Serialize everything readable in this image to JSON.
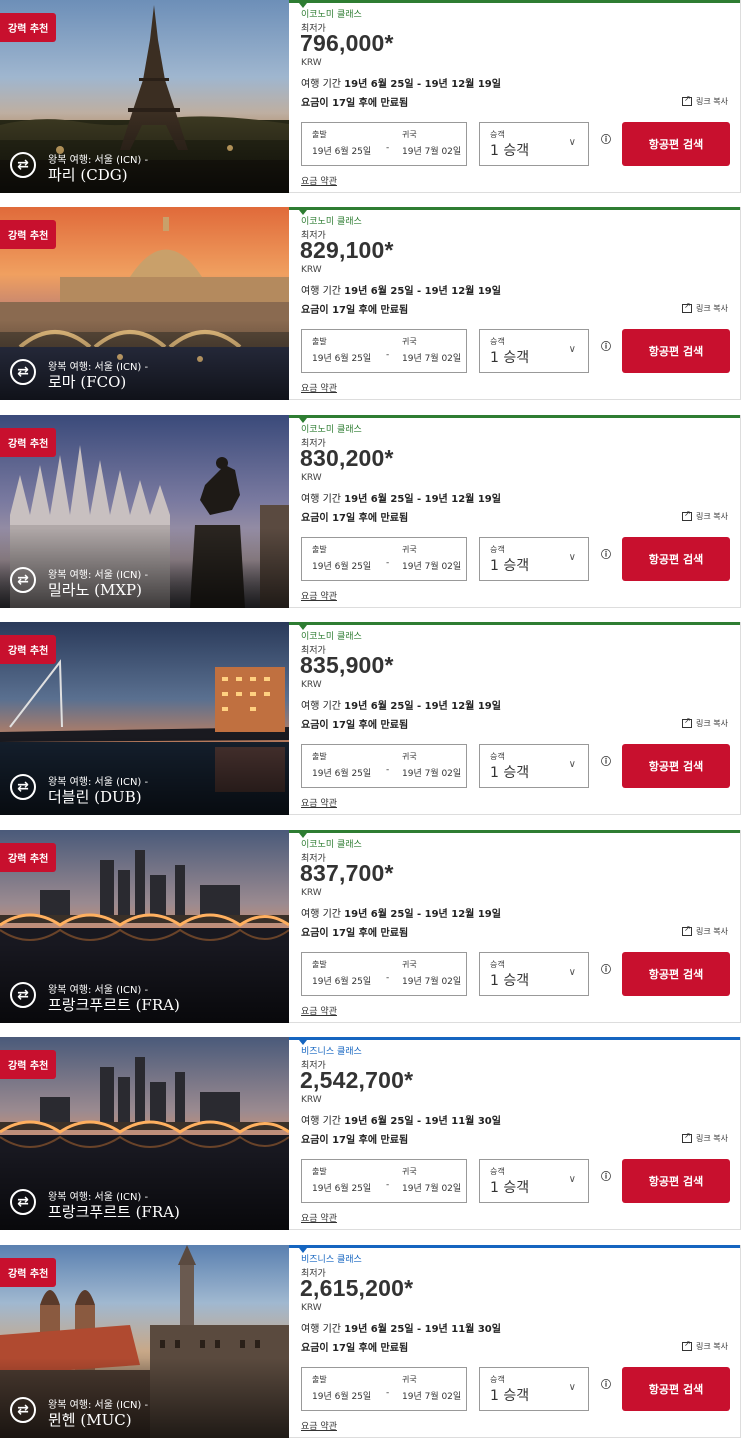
{
  "common": {
    "badge": "강력 추천",
    "route_prefix": "왕복 여행: 서울 (ICN) -",
    "lowest_label": "최저가",
    "currency": "KRW",
    "period_prefix": "여행 기간",
    "expiry": "요금이 17일 후에 만료됨",
    "copy_link": "링크 복사",
    "depart_label": "출발",
    "return_label": "귀국",
    "depart_date": "19년 6월 25일",
    "return_date": "19년 7월 02일",
    "dash": "-",
    "pax_label": "승객",
    "pax_value": "1 승객",
    "info_icon": "ⓘ",
    "search_button": "항공편 검색",
    "terms": "요금 약관",
    "colors": {
      "brand_red": "#c8102e",
      "economy_green": "#2e7d32",
      "business_blue": "#1565c0"
    }
  },
  "cards": [
    {
      "city": "파리 (CDG)",
      "cabin": "이코노미 클래스",
      "cabin_type": "economy",
      "price": "796,000*",
      "period": "19년 6월 25일 - 19년 12월 19일",
      "image": "paris-eiffel-tower"
    },
    {
      "city": "로마 (FCO)",
      "cabin": "이코노미 클래스",
      "cabin_type": "economy",
      "price": "829,100*",
      "period": "19년 6월 25일 - 19년 12월 19일",
      "image": "rome-st-peters"
    },
    {
      "city": "밀라노 (MXP)",
      "cabin": "이코노미 클래스",
      "cabin_type": "economy",
      "price": "830,200*",
      "period": "19년 6월 25일 - 19년 12월 19일",
      "image": "milan-duomo"
    },
    {
      "city": "더블린 (DUB)",
      "cabin": "이코노미 클래스",
      "cabin_type": "economy",
      "price": "835,900*",
      "period": "19년 6월 25일 - 19년 12월 19일",
      "image": "dublin-river"
    },
    {
      "city": "프랑크푸르트 (FRA)",
      "cabin": "이코노미 클래스",
      "cabin_type": "economy",
      "price": "837,700*",
      "period": "19년 6월 25일 - 19년 12월 19일",
      "image": "frankfurt-skyline"
    },
    {
      "city": "프랑크푸르트 (FRA)",
      "cabin": "비즈니스 클래스",
      "cabin_type": "business",
      "price": "2,542,700*",
      "period": "19년 6월 25일 - 19년 11월 30일",
      "image": "frankfurt-skyline"
    },
    {
      "city": "뮌헨 (MUC)",
      "cabin": "비즈니스 클래스",
      "cabin_type": "business",
      "price": "2,615,200*",
      "period": "19년 6월 25일 - 19년 11월 30일",
      "image": "munich-city"
    }
  ]
}
